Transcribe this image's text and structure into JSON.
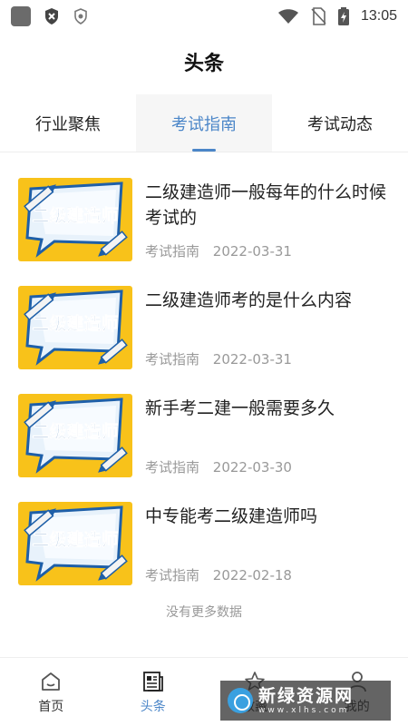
{
  "status_bar": {
    "time": "13:05"
  },
  "header": {
    "title": "头条"
  },
  "tabs": [
    {
      "label": "行业聚焦",
      "active": false
    },
    {
      "label": "考试指南",
      "active": true
    },
    {
      "label": "考试动态",
      "active": false
    }
  ],
  "articles": [
    {
      "title": "二级建造师一般每年的什么时候考试的",
      "category": "考试指南",
      "date": "2022-03-31",
      "thumb_text": "二级建造师"
    },
    {
      "title": "二级建造师考的是什么内容",
      "category": "考试指南",
      "date": "2022-03-31",
      "thumb_text": "二级建造师"
    },
    {
      "title": "新手考二建一般需要多久",
      "category": "考试指南",
      "date": "2022-03-30",
      "thumb_text": "二级建造师"
    },
    {
      "title": "中专能考二级建造师吗",
      "category": "考试指南",
      "date": "2022-02-18",
      "thumb_text": "二级建造师"
    }
  ],
  "no_more": "没有更多数据",
  "bottom_nav": [
    {
      "label": "首页",
      "icon": "home-icon",
      "active": false
    },
    {
      "label": "头条",
      "icon": "news-icon",
      "active": true
    },
    {
      "label": "收藏",
      "icon": "star-icon",
      "active": false
    },
    {
      "label": "我的",
      "icon": "person-icon",
      "active": false
    }
  ],
  "watermark": {
    "main": "新绿资源网",
    "sub": "www.xlhs.com"
  },
  "colors": {
    "accent": "#4b86c8",
    "thumb_bg": "#f8c21a",
    "meta": "#999999"
  }
}
